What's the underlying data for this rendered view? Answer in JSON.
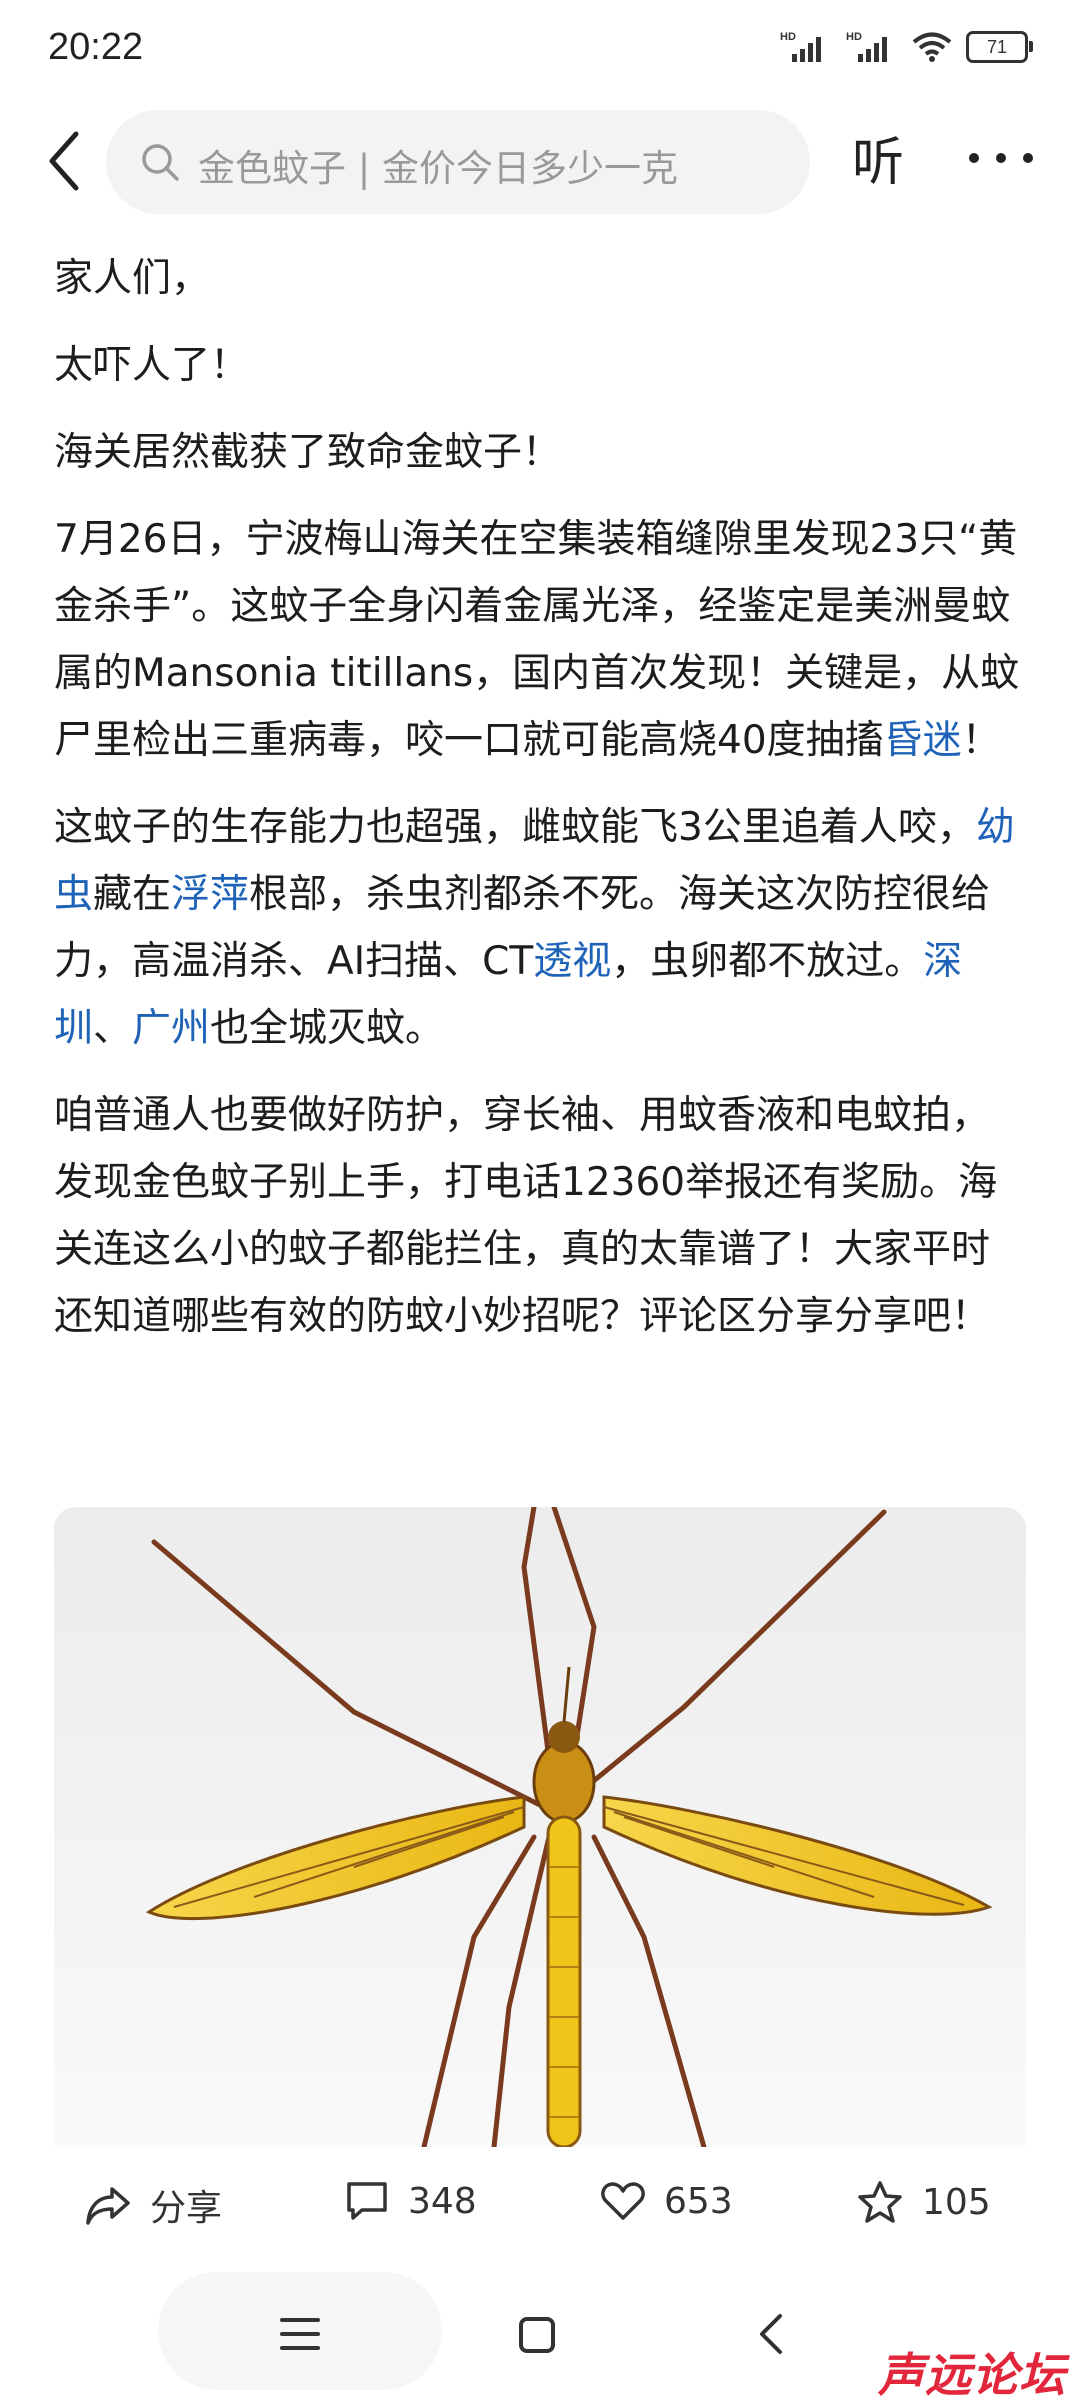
{
  "status_bar": {
    "time": "20:22",
    "battery": "71",
    "signal1": "HD",
    "signal2": "HD"
  },
  "header": {
    "search_placeholder": "金色蚊子 | 金价今日多少一克",
    "listen_label": "听"
  },
  "article": {
    "p1": "家人们，",
    "p2": "太吓人了！",
    "p3": "海关居然截获了致命金蚊子！",
    "p4": "7月26日，宁波梅山海关在空集装箱缝隙里发现23只“黄金杀手”。这蚊子全身闪着金属光泽，经鉴定是美洲曼蚊属的Mansonia titillans，国内首次发现！关键是，从蚊尸里检出三重病毒，咬一口就可能高烧40度抽搐",
    "p4_link": "昏迷",
    "p4_end": "！",
    "p5_a": "这蚊子的生存能力也超强，雌蚊能飞3公里追着人咬，",
    "p5_link1": "幼虫",
    "p5_b": "藏在",
    "p5_link2": "浮萍",
    "p5_c": "根部，杀虫剂都杀不死。海关这次防控很给力，高温消杀、AI扫描、CT",
    "p5_link3": "透视",
    "p5_d": "，虫卵都不放过。",
    "p5_link4": "深圳",
    "p5_e": "、",
    "p5_link5": "广州",
    "p5_f": "也全城灭蚊。",
    "p6": "咱普通人也要做好防护，穿长袖、用蚊香液和电蚊拍，发现金色蚊子别上手，打电话12360举报还有奖励。海关连这么小的蚊子都能拦住，真的太靠谱了！大家平时还知道哪些有效的防蚊小妙招呢？评论区分享分享吧！"
  },
  "actions": {
    "share_label": "分享",
    "comments": "348",
    "likes": "653",
    "favorites": "105"
  },
  "watermark": "声远论坛",
  "colors": {
    "link": "#1e63b8",
    "watermark": "#e2263b",
    "wing": "#f2c21a"
  },
  "icons": [
    "back-icon",
    "search-icon",
    "more-icon",
    "share-icon",
    "comment-icon",
    "like-icon",
    "star-icon",
    "menu-icon",
    "home-icon",
    "nav-back-icon"
  ]
}
